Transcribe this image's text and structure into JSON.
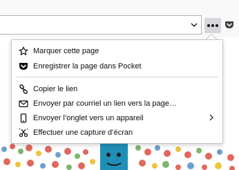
{
  "menu": {
    "items": [
      {
        "label": "Marquer cette page",
        "icon": "star-icon"
      },
      {
        "label": "Enregistrer la page dans Pocket",
        "icon": "pocket-icon"
      },
      {
        "label": "Copier le lien",
        "icon": "link-icon"
      },
      {
        "label": "Envoyer par courriel un lien vers la page…",
        "icon": "mail-icon"
      },
      {
        "label": "Envoyer l’onglet vers un appareil",
        "icon": "device-icon"
      },
      {
        "label": "Effectuer une capture d’écran",
        "icon": "screenshot-icon"
      }
    ]
  }
}
